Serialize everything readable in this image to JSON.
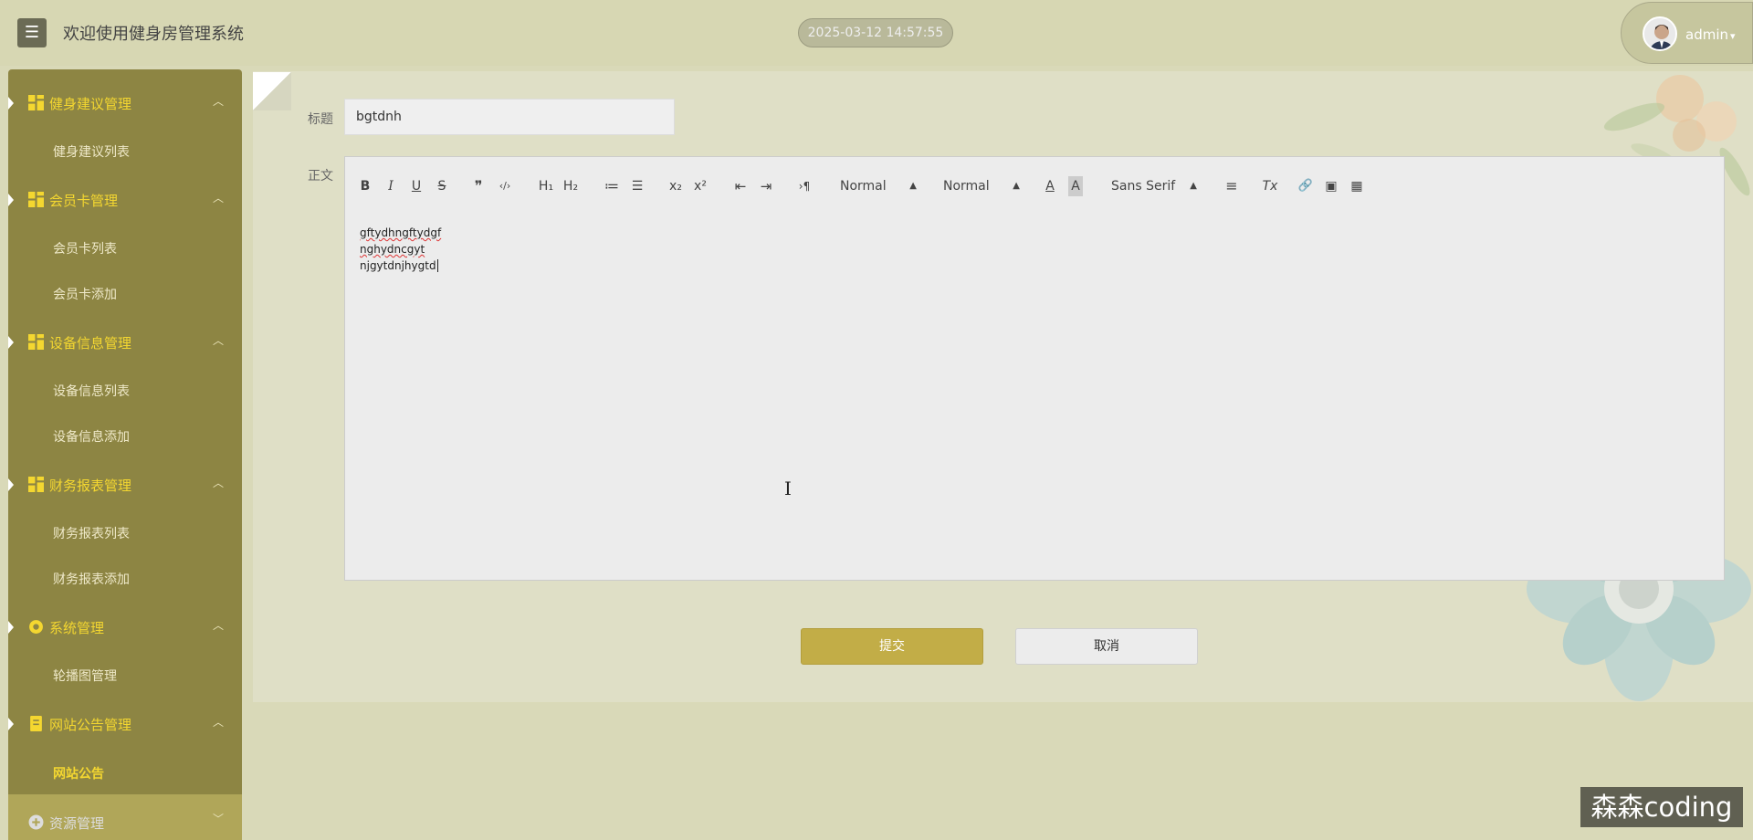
{
  "header": {
    "menu_icon": "hamburger-icon",
    "title": "欢迎使用健身房管理系统",
    "datetime": "2025-03-12 14:57:55",
    "user_name": "admin",
    "user_chevron": "⌄"
  },
  "sidebar": {
    "groups": [
      {
        "label": "健身建议管理",
        "icon": "grid-icon",
        "items": [
          "健身建议列表"
        ]
      },
      {
        "label": "会员卡管理",
        "icon": "grid-icon",
        "items": [
          "会员卡列表",
          "会员卡添加"
        ]
      },
      {
        "label": "设备信息管理",
        "icon": "grid-icon",
        "items": [
          "设备信息列表",
          "设备信息添加"
        ]
      },
      {
        "label": "财务报表管理",
        "icon": "grid-icon",
        "items": [
          "财务报表列表",
          "财务报表添加"
        ]
      },
      {
        "label": "系统管理",
        "icon": "gear-icon",
        "items": [
          "轮播图管理"
        ]
      },
      {
        "label": "网站公告管理",
        "icon": "document-icon",
        "items": [
          "网站公告"
        ]
      },
      {
        "label": "资源管理",
        "icon": "plus-circle-icon",
        "items": []
      }
    ],
    "active_item": "网站公告"
  },
  "form": {
    "title_label": "标题",
    "title_value": "bgtdnh",
    "body_label": "正文",
    "toolbar": {
      "bold": "B",
      "italic": "I",
      "underline": "U",
      "strike": "S",
      "blockquote": "❞",
      "code": "‹/›",
      "h1": "H₁",
      "h2": "H₂",
      "ordered_list": "≔",
      "bullet_list": "☰",
      "subscript": "x₂",
      "superscript": "x²",
      "outdent": "⇤",
      "indent": "⇥",
      "direction": "›¶",
      "size_select": "Normal",
      "header_select": "Normal",
      "color": "A",
      "background": "A",
      "font_select": "Sans Serif",
      "align": "≡",
      "clean": "Tx",
      "link": "🔗",
      "image": "▣",
      "video": "▦"
    },
    "body_lines": [
      "gftydhngftydgf",
      "nghydncgyt",
      "njgytdnjhygtd"
    ],
    "submit_label": "提交",
    "cancel_label": "取消"
  },
  "watermark": "森森coding",
  "colors": {
    "accent": "#c2ad47",
    "sidebar_bg": "#8d8543",
    "sidebar_active_text": "#f4d730",
    "header_bg": "#d7d7b3"
  }
}
